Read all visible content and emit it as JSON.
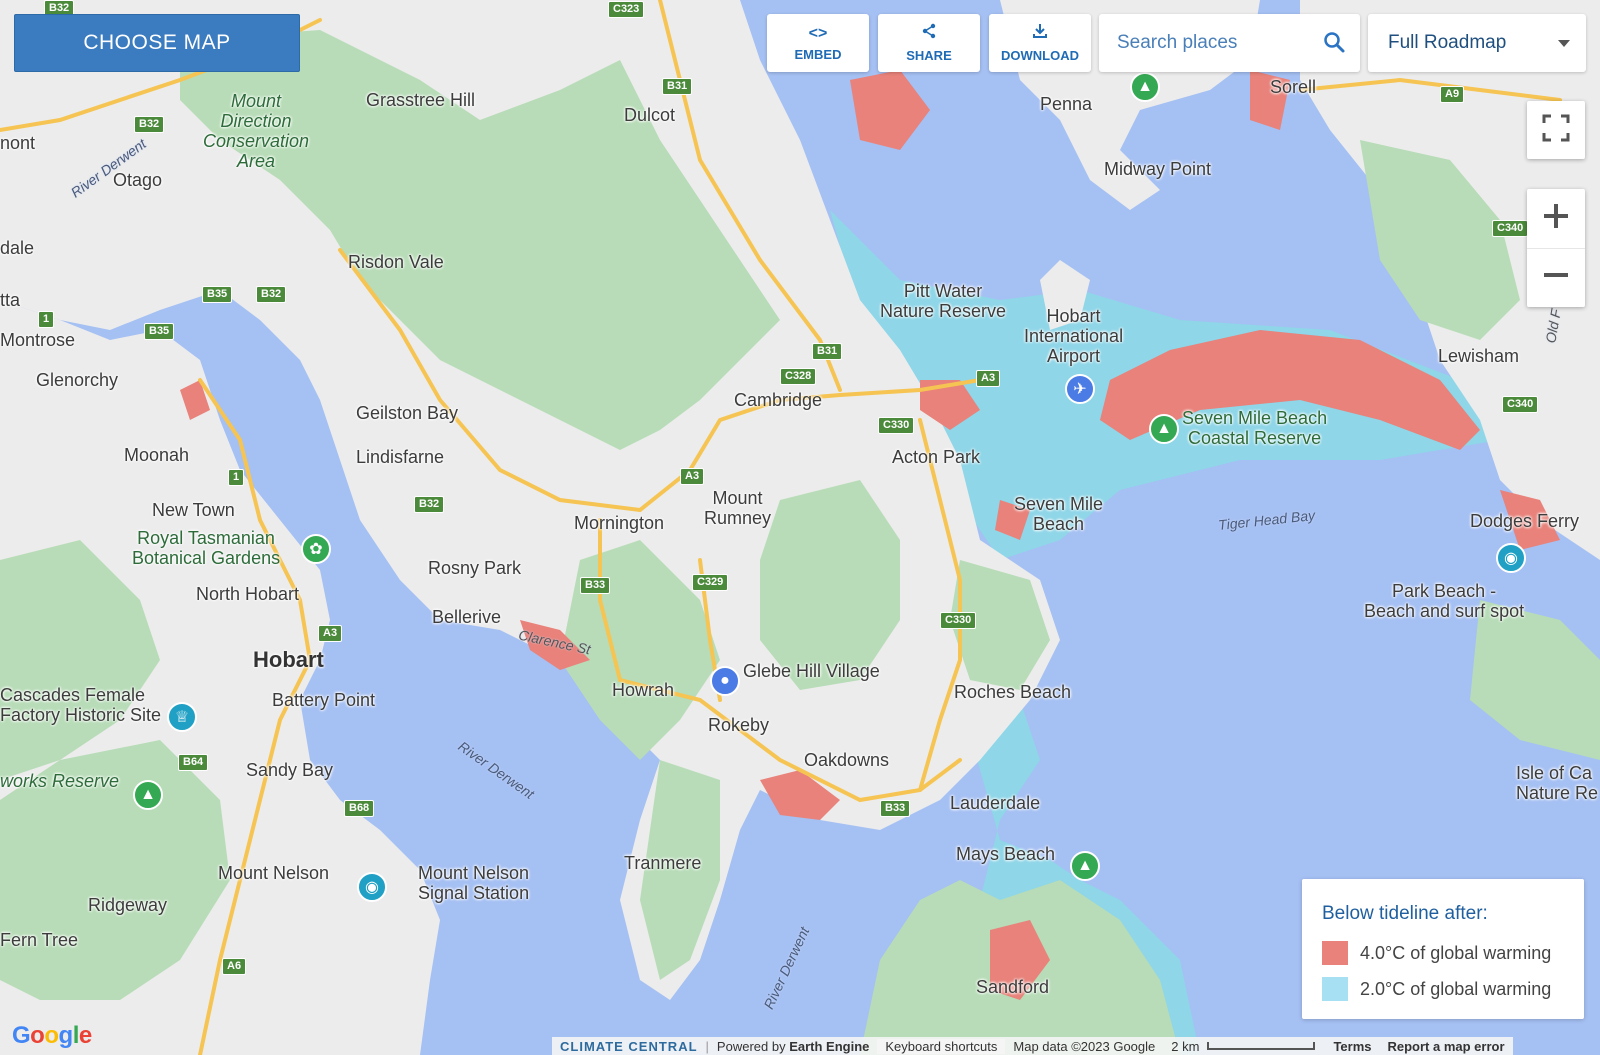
{
  "toolbar": {
    "choose_map": "CHOOSE MAP",
    "embed": "EMBED",
    "share": "SHARE",
    "download": "DOWNLOAD",
    "search_placeholder": "Search places",
    "map_type": "Full Roadmap"
  },
  "icons": {
    "embed": "code-icon",
    "share": "share-icon",
    "download": "download-icon",
    "search": "search-icon",
    "fullscreen": "fullscreen-icon",
    "zoom_in": "plus-icon",
    "zoom_out": "minus-icon"
  },
  "legend": {
    "title": "Below tideline after:",
    "items": [
      {
        "label": "4.0°C of global warming",
        "color": "#e8827a"
      },
      {
        "label": "2.0°C of global warming",
        "color": "#a6e0f2"
      }
    ]
  },
  "colors": {
    "water": "#a5c0f3",
    "land": "#ececec",
    "park": "#b7dcb7",
    "flood_4c": "#e8827a",
    "flood_2c": "#8ed6e8",
    "road": "#f6c452",
    "accent": "#3b7bbf"
  },
  "places": [
    {
      "name": "Grasstree Hill"
    },
    {
      "name": "Dulcot"
    },
    {
      "name": "Penna"
    },
    {
      "name": "Sorell"
    },
    {
      "name": "Midway Point"
    },
    {
      "name": "Otago"
    },
    {
      "name": "Mount\nDirection\nConservation\nArea"
    },
    {
      "name": "Risdon Vale"
    },
    {
      "name": "Pitt Water\nNature Reserve"
    },
    {
      "name": "Hobart\nInternational\nAirport"
    },
    {
      "name": "Lewisham"
    },
    {
      "name": "Montrose"
    },
    {
      "name": "Glenorchy"
    },
    {
      "name": "Geilston Bay"
    },
    {
      "name": "Cambridge"
    },
    {
      "name": "Seven Mile Beach\nCoastal Reserve"
    },
    {
      "name": "Moonah"
    },
    {
      "name": "Lindisfarne"
    },
    {
      "name": "Acton Park"
    },
    {
      "name": "New Town"
    },
    {
      "name": "Mount\nRumney"
    },
    {
      "name": "Seven Mile\nBeach"
    },
    {
      "name": "Dodges Ferry"
    },
    {
      "name": "Royal Tasmanian\nBotanical Gardens"
    },
    {
      "name": "Mornington"
    },
    {
      "name": "Rosny Park"
    },
    {
      "name": "North Hobart"
    },
    {
      "name": "Park Beach -\nBeach and surf spot"
    },
    {
      "name": "Bellerive"
    },
    {
      "name": "Hobart"
    },
    {
      "name": "Glebe Hill Village"
    },
    {
      "name": "Cascades Female\nFactory Historic Site"
    },
    {
      "name": "Battery Point"
    },
    {
      "name": "Howrah"
    },
    {
      "name": "Roches Beach"
    },
    {
      "name": "Rokeby"
    },
    {
      "name": "Oakdowns"
    },
    {
      "name": "Sandy Bay"
    },
    {
      "name": "Isle of Ca\nNature Re"
    },
    {
      "name": "Lauderdale"
    },
    {
      "name": "Mays Beach"
    },
    {
      "name": "Mount Nelson"
    },
    {
      "name": "Mount Nelson\nSignal Station"
    },
    {
      "name": "Tranmere"
    },
    {
      "name": "Ridgeway"
    },
    {
      "name": "Fern Tree"
    },
    {
      "name": "Sandford"
    },
    {
      "name": "works Reserve"
    },
    {
      "name": "dale"
    },
    {
      "name": "nont"
    },
    {
      "name": "tta"
    }
  ],
  "water_labels": [
    "River Derwent",
    "River Derwent",
    "River Derwent",
    "Tiger Head Bay",
    "Clarence St",
    "Old F"
  ],
  "routes": [
    "C323",
    "B32",
    "B31",
    "B32",
    "B35",
    "B32",
    "A9",
    "C340",
    "B35",
    "1",
    "B31",
    "C328",
    "A3",
    "C330",
    "C340",
    "1",
    "A3",
    "B32",
    "B33",
    "C329",
    "C330",
    "A3",
    "B64",
    "B68",
    "B33",
    "A6"
  ],
  "attribution": {
    "brand": "CLIMATE CENTRAL",
    "powered": "Powered by",
    "engine": "Earth Engine",
    "shortcuts": "Keyboard shortcuts",
    "mapdata": "Map data ©2023 Google",
    "scale": "2 km",
    "terms": "Terms",
    "report": "Report a map error"
  },
  "google_logo": "Google"
}
